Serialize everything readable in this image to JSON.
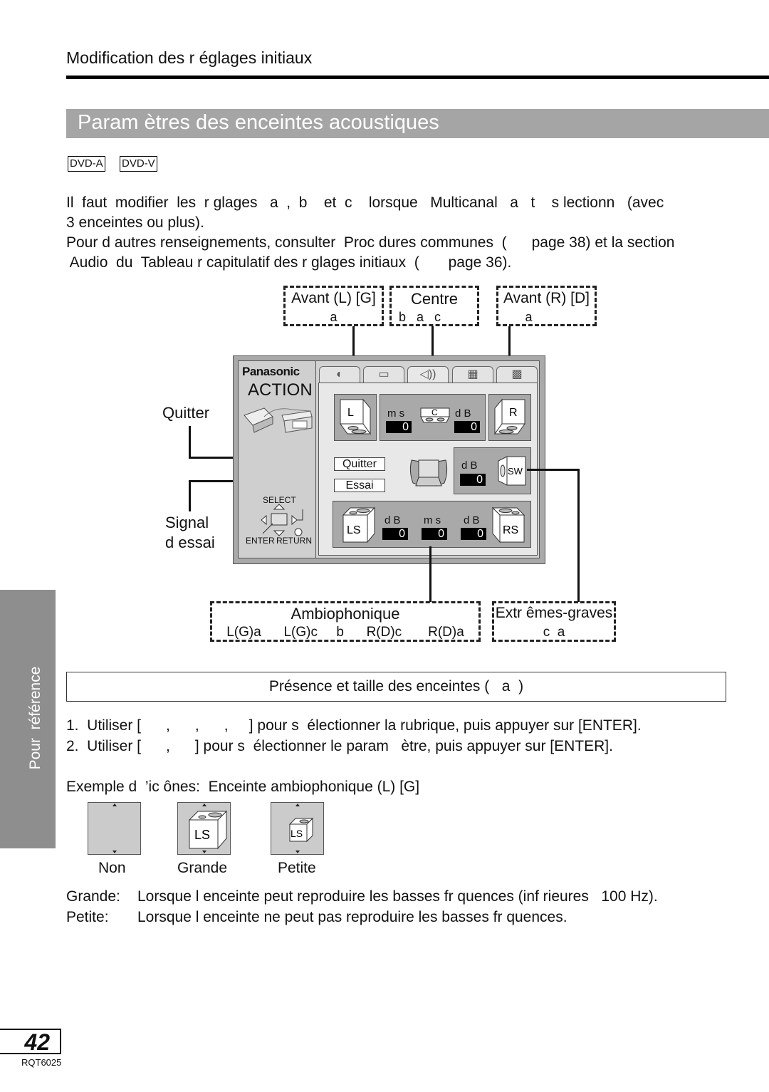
{
  "header": {
    "section": "Modification des r  églages initiaux",
    "title": "Param ètres des enceintes acoustiques"
  },
  "badges": [
    "DVD-A",
    "DVD-V"
  ],
  "intro": {
    "line1": "Il  faut  modifier  les  r glages   a  ,  b    et  c    lorsque   Multicanal   a   t    s lectionn   (avec",
    "line2": "3 enceintes ou plus).",
    "line3": "Pour d autres renseignements, consulter  Proc dures communes  (      page 38) et la section",
    "line4": " Audio  du  Tableau r capitulatif des r glages initiaux  (       page 36)."
  },
  "callouts": {
    "front_left": {
      "title": "Avant (L) [G]",
      "sub": "a"
    },
    "center": {
      "title": "Centre",
      "sub": "b   a   c"
    },
    "front_right": {
      "title": "Avant (R) [D]",
      "sub": "a"
    },
    "surround": {
      "title": "Ambiophonique",
      "sub": "L(G)a      L(G)c     b      R(D)c       R(D)a"
    },
    "subwoofer": {
      "title": "Extr êmes-graves",
      "sub": "c  a"
    },
    "quit": "Quitter",
    "test_signal_1": "Signal",
    "test_signal_2": "d essai"
  },
  "screen": {
    "brand": "Panasonic",
    "brand_sub": "ACTION",
    "tabs": [
      {
        "icon": "disc-icon",
        "glyph": "◐",
        "active": false
      },
      {
        "icon": "display-icon",
        "glyph": "▭",
        "active": false
      },
      {
        "icon": "speaker-icon",
        "glyph": "◁))",
        "active": true
      },
      {
        "icon": "setup-icon",
        "glyph": "▦",
        "active": false
      },
      {
        "icon": "grid-icon",
        "glyph": "▩",
        "active": false
      }
    ],
    "speakers": {
      "L": "L",
      "C": "C",
      "R": "R",
      "SW": "SW",
      "LS": "LS",
      "RS": "RS"
    },
    "units": {
      "ms": "m s",
      "db": "d B"
    },
    "values": {
      "center_ms": "0",
      "center_db": "0",
      "sw_db": "0",
      "ls_db": "0",
      "surround_ms": "0",
      "rs_db": "0"
    },
    "buttons": {
      "quit": "Quitter",
      "test": "Essai"
    },
    "remote": {
      "select": "SELECT",
      "enter": "ENTER",
      "return": "RETURN"
    }
  },
  "presence_title": "Présence et taille des enceintes (   a  )",
  "steps": [
    "1.  Utiliser [      ,      ,      ,     ] pour s  électionner la rubrique, puis appuyer sur [ENTER].",
    "2.  Utiliser [      ,      ] pour s  électionner le param   ètre, puis appuyer sur [ENTER]."
  ],
  "example_label": "Exemple d  ’ic ônes:  Enceinte ambiophonique (L) [G]",
  "icon_examples": [
    {
      "label": "Non",
      "speaker": ""
    },
    {
      "label": "Grande",
      "speaker": "LS"
    },
    {
      "label": "Petite",
      "speaker": "LS"
    }
  ],
  "definitions": [
    {
      "term": "Grande:",
      "text": "Lorsque l enceinte peut reproduire les basses fr quences (inf rieures   100 Hz)."
    },
    {
      "term": "Petite:",
      "text": "Lorsque l enceinte ne peut pas reproduire les basses fr quences."
    }
  ],
  "side_tab": "Pour  référence",
  "footer": {
    "page_number": "42",
    "doc_code": "RQT6025"
  },
  "colors": {
    "title_bar": "#a5a5a5",
    "side_tab": "#8e8e8e",
    "screen_frame": "#a9a9a9"
  }
}
